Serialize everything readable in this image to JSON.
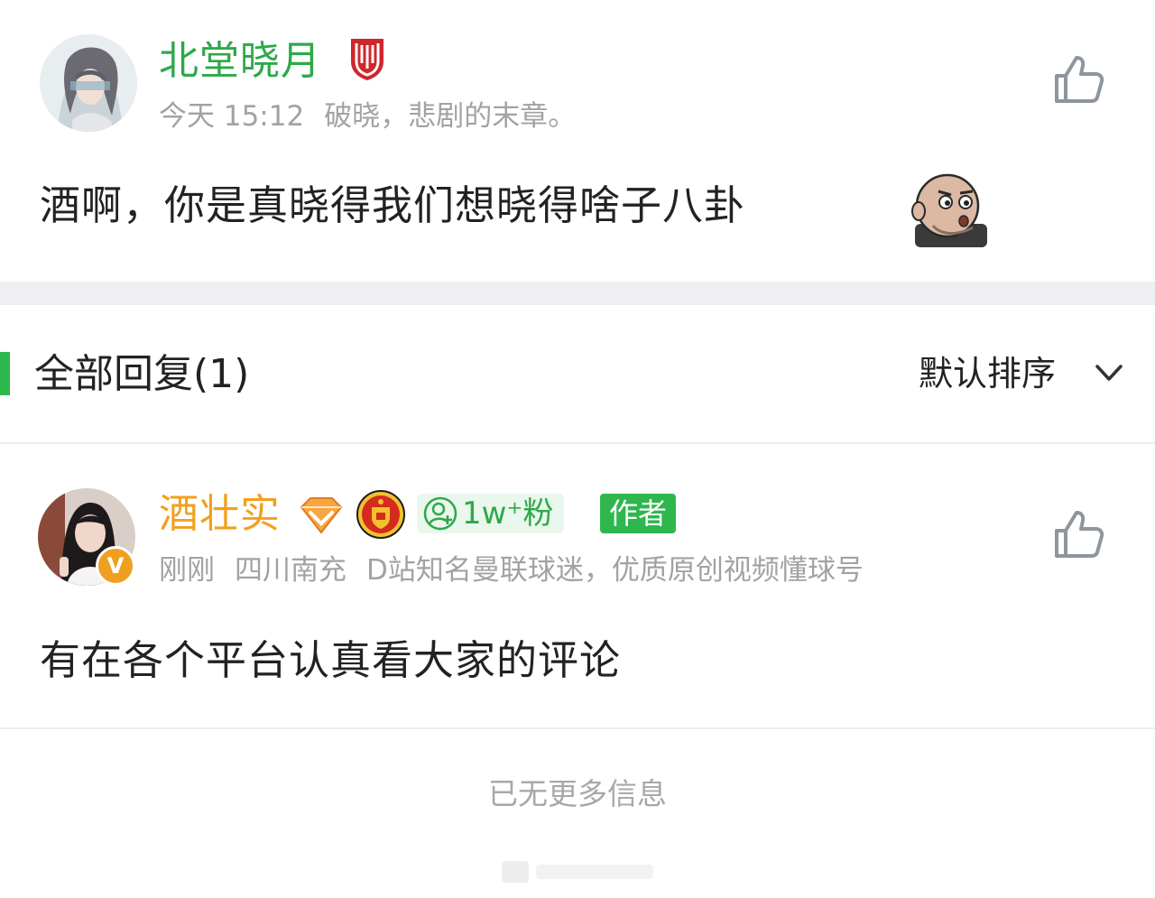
{
  "comment": {
    "username": "北堂晓月",
    "time": "今天 15:12",
    "signature": "破晓，悲剧的末章。",
    "text": "酒啊，你是真晓得我们想晓得啥子八卦",
    "badge_icon": "red-shield-icon",
    "emoji_icon": "bald-head-emoji"
  },
  "replies_header": {
    "title": "全部回复(1)",
    "sort_label": "默认排序"
  },
  "reply": {
    "username": "酒壮实",
    "verified_badge": "V",
    "fans_label": "1w⁺粉",
    "author_tag": "作者",
    "time": "刚刚",
    "location": "四川南充",
    "bio": "D站知名曼联球迷，优质原创视频懂球号",
    "text": "有在各个平台认真看大家的评论"
  },
  "footer": {
    "no_more": "已无更多信息"
  },
  "colors": {
    "brand_green": "#2ea84a",
    "author_orange": "#f2a01e",
    "meta_gray": "#a2a2a2",
    "divider": "#efeff1"
  }
}
